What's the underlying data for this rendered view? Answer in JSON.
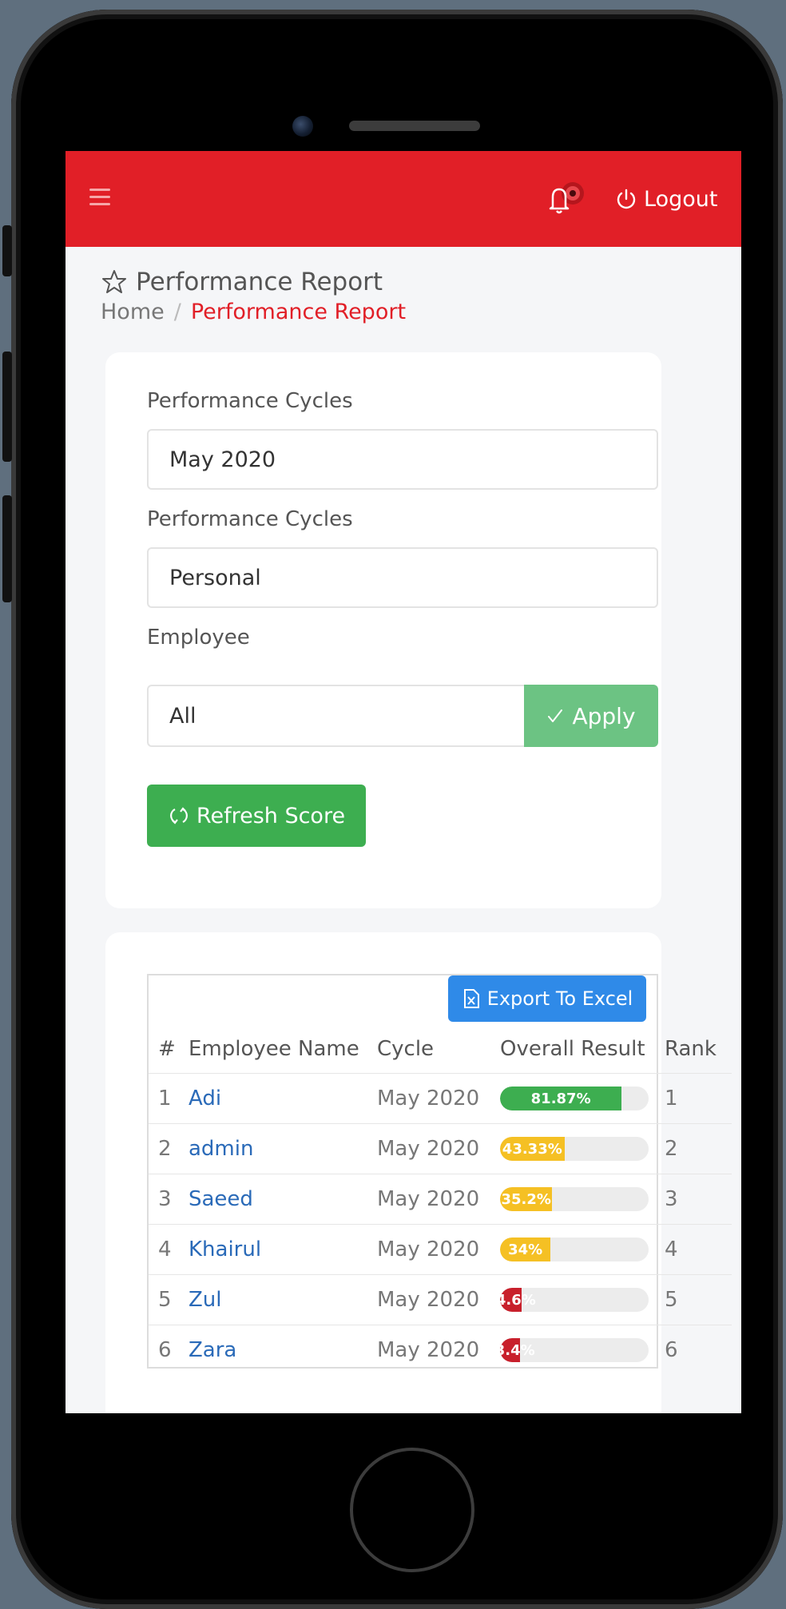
{
  "header": {
    "menu_icon": "hamburger-icon",
    "notification_icon": "bell-icon",
    "logout_label": "Logout",
    "logout_icon": "power-icon",
    "accent_color": "#e11f27"
  },
  "page": {
    "title": "Performance Report",
    "title_icon": "star-outline-icon",
    "breadcrumb": {
      "home": "Home",
      "separator": "/",
      "current": "Performance Report"
    }
  },
  "filters": {
    "cycle_label": "Performance Cycles",
    "cycle_value": "May 2020",
    "type_label": "Performance Cycles",
    "type_value": "Personal",
    "employee_label": "Employee",
    "employee_value": "All",
    "apply_label": "Apply",
    "apply_icon": "check-icon",
    "refresh_label": "Refresh Score",
    "refresh_icon": "refresh-icon"
  },
  "report": {
    "export_label": "Export To Excel",
    "export_icon": "excel-file-icon",
    "columns": [
      "#",
      "Employee Name",
      "Cycle",
      "Overall Result",
      "Rank"
    ],
    "rows": [
      {
        "num": "1",
        "name": "Adi",
        "cycle": "May 2020",
        "result_label": "81.87%",
        "result": 81.87,
        "color": "#3dae50",
        "rank": "1"
      },
      {
        "num": "2",
        "name": "admin",
        "cycle": "May 2020",
        "result_label": "43.33%",
        "result": 43.33,
        "color": "#f5c024",
        "rank": "2"
      },
      {
        "num": "3",
        "name": "Saeed",
        "cycle": "May 2020",
        "result_label": "35.2%",
        "result": 35.2,
        "color": "#f5c024",
        "rank": "3"
      },
      {
        "num": "4",
        "name": "Khairul",
        "cycle": "May 2020",
        "result_label": "34%",
        "result": 34,
        "color": "#f5c024",
        "rank": "4"
      },
      {
        "num": "5",
        "name": "Zul",
        "cycle": "May 2020",
        "result_label": "14.6%",
        "result": 14.6,
        "color": "#c8202c",
        "rank": "5"
      },
      {
        "num": "6",
        "name": "Zara",
        "cycle": "May 2020",
        "result_label": "13.4%",
        "result": 13.4,
        "color": "#c8202c",
        "rank": "6"
      }
    ]
  }
}
